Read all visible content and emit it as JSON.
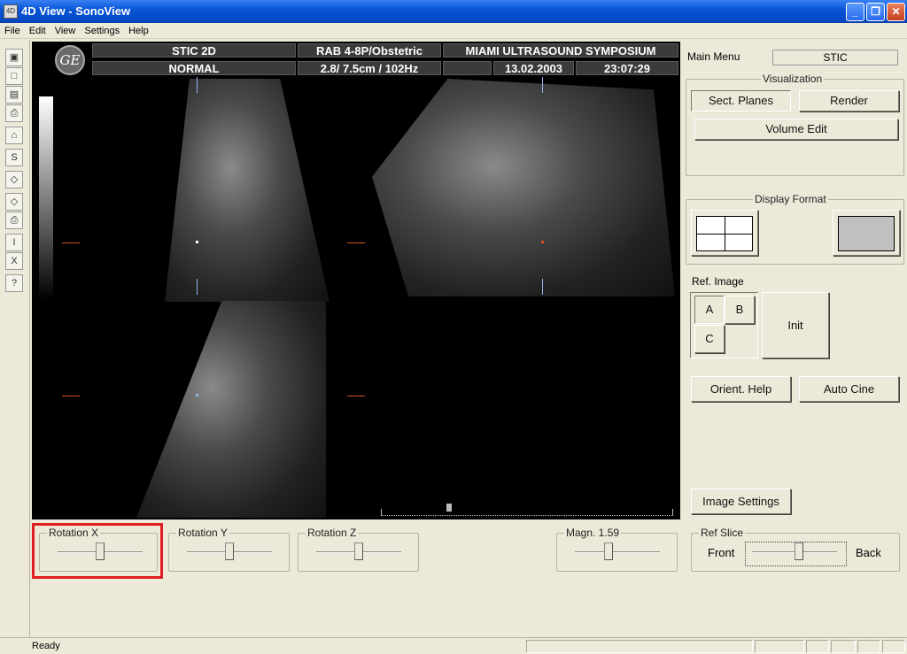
{
  "window": {
    "title": "4D View - SonoView",
    "icon": "sonoview-app-icon"
  },
  "menu": [
    "File",
    "Edit",
    "View",
    "Settings",
    "Help"
  ],
  "toolbar": [
    "open-folder-icon",
    "new-file-icon",
    "save-icon",
    "print-icon",
    "patient-icon",
    "s-icon",
    "rotate-icon",
    "arrow-icon",
    "print-color-icon",
    "report-icon",
    "report-edit-icon",
    "help-icon"
  ],
  "toolbar_glyphs": [
    "▣",
    "□",
    "▤",
    "⎙",
    "⌂",
    "S",
    "◇",
    "◇",
    "⎙",
    "I",
    "X",
    "?"
  ],
  "header": {
    "logo": "GE",
    "mode": "STIC 2D",
    "mode2": "NORMAL",
    "probe": "RAB 4-8P/Obstetric",
    "params": "2.8/ 7.5cm / 102Hz",
    "site": "MIAMI ULTRASOUND SYMPOSIUM",
    "date": "13.02.2003",
    "time": "23:07:29"
  },
  "right_panel": {
    "main_menu_label": "Main Menu",
    "main_menu_value": "STIC",
    "visualization": {
      "label": "Visualization",
      "sect_planes": "Sect. Planes",
      "render": "Render",
      "volume_edit": "Volume Edit"
    },
    "display_format": {
      "label": "Display Format"
    },
    "ref_image": {
      "label": "Ref. Image",
      "a": "A",
      "b": "B",
      "c": "C",
      "init": "Init"
    },
    "orient_help": "Orient. Help",
    "auto_cine": "Auto Cine",
    "image_settings": "Image Settings"
  },
  "controls": {
    "rotation_x": {
      "label": "Rotation X",
      "level": 0.5
    },
    "rotation_y": {
      "label": "Rotation Y",
      "level": 0.5
    },
    "rotation_z": {
      "label": "Rotation Z",
      "level": 0.5
    },
    "magn": {
      "label": "Magn. 1.59",
      "level": 0.4
    },
    "ref_slice": {
      "label": "Ref Slice",
      "front": "Front",
      "back": "Back",
      "level": 0.55
    }
  },
  "status": {
    "text": "Ready"
  },
  "colors": {
    "title_bar": "#0a56d6",
    "panel_bg": "#ece9d8",
    "highlight": "#e02020",
    "marker": "#d9531e"
  }
}
